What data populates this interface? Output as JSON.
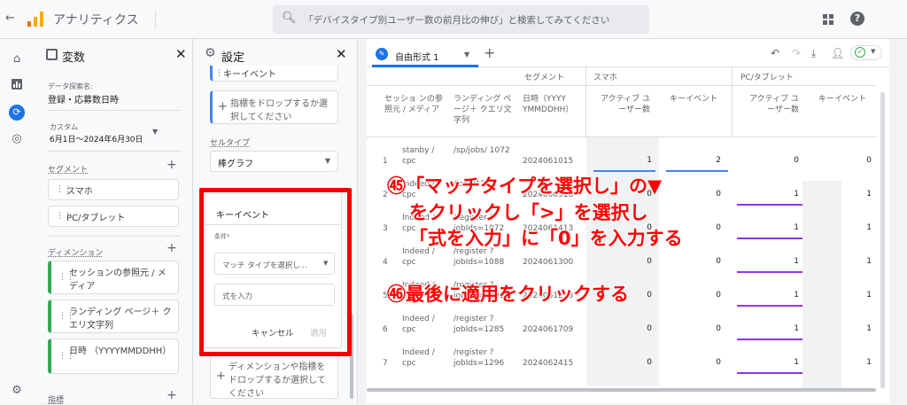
{
  "app": {
    "title": "アナリティクス",
    "back_icon": "arrow-left",
    "logo": "analytics-bars"
  },
  "search": {
    "placeholder": "「デバイスタイプ別ユーザー数の前月比の伸び」と検索してみてください"
  },
  "variables": {
    "title": "変数",
    "explore_label": "データ探索名:",
    "explore_name": "登録・応募数日時",
    "date_label": "カスタム",
    "date_range": "6月1日～2024年6月30日",
    "segments_label": "セグメント",
    "segments": [
      "スマホ",
      "PC/タブレット"
    ],
    "dimensions_label": "ディメンション",
    "dimensions": [
      "セッションの参照元 / メディア",
      "ランディング ページ＋ クエリ文字列",
      "日時 （YYYYMMDDHH）"
    ],
    "metrics_label": "指標"
  },
  "settings": {
    "title": "設定",
    "metric_top": "キーイベント",
    "drop_metric": "指標をドロップするか選択してください",
    "cell_type_label": "セルタイプ",
    "cell_type": "棒グラフ",
    "filter_title": "キーイベント",
    "condition_label": "条件*",
    "match_type_placeholder": "マッチ タイプを選択し...",
    "expression_placeholder": "式を入力",
    "cancel": "キャンセル",
    "apply": "適用",
    "drop_dim": "ディメンションや指標をドロップするか選択してください"
  },
  "tab": {
    "name": "自由形式 1"
  },
  "table": {
    "headers": {
      "segment": "セグメント",
      "smartphone": "スマホ",
      "pc": "PC/タブレット",
      "source": "セッショ ンの参照元 / メディア",
      "landing": "ランディング ページ＋ クエリ文字列",
      "datetime": "日時（YYYY YMMDDHH）",
      "active": "アクティブ ユーザー数",
      "key_events": "キーイベント"
    },
    "rows": [
      {
        "n": "1",
        "src": "stanby / cpc",
        "lp": "/sp/jobs/ 1072",
        "dt": "2024061015",
        "a1": "1",
        "k1": "2",
        "a2": "0",
        "k2": "0"
      },
      {
        "n": "2",
        "src": "Indeed / cpc",
        "lp": "/jobs/1288",
        "dt": "2024060518",
        "a1": "0",
        "k1": "0",
        "a2": "1",
        "k2": "1"
      },
      {
        "n": "3",
        "src": "Indeed / cpc",
        "lp": "/register ?jobIds=1072",
        "dt": "2024061413",
        "a1": "0",
        "k1": "0",
        "a2": "1",
        "k2": "1"
      },
      {
        "n": "4",
        "src": "Indeed / cpc",
        "lp": "/register ?jobIds=1088",
        "dt": "2024061300",
        "a1": "0",
        "k1": "0",
        "a2": "1",
        "k2": "1"
      },
      {
        "n": "5",
        "src": "Indeed / cpc",
        "lp": "/register ?jobIds=1091",
        "dt": "2024061215",
        "a1": "0",
        "k1": "0",
        "a2": "1",
        "k2": "1"
      },
      {
        "n": "6",
        "src": "Indeed / cpc",
        "lp": "/register ?jobIds=1285",
        "dt": "2024061709",
        "a1": "0",
        "k1": "0",
        "a2": "1",
        "k2": "1"
      },
      {
        "n": "7",
        "src": "Indeed / cpc",
        "lp": "/register ?jobIds=1296",
        "dt": "2024062415",
        "a1": "0",
        "k1": "0",
        "a2": "1",
        "k2": "1"
      }
    ]
  },
  "annotations": {
    "a45_line1": "㊺「マッチタイプを選択し」の▼",
    "a45_line2": "をクリックし「>」を選択し",
    "a45_line3": "「式を入力」に「0」を入力する",
    "a46": "㊻最後に適用をクリックする"
  },
  "colors": {
    "accent": "#1a73e8",
    "annotation": "#ff0000",
    "bar_purple": "#9334e6",
    "bar_blue": "#4285f4",
    "green_chip": "#34a853"
  }
}
